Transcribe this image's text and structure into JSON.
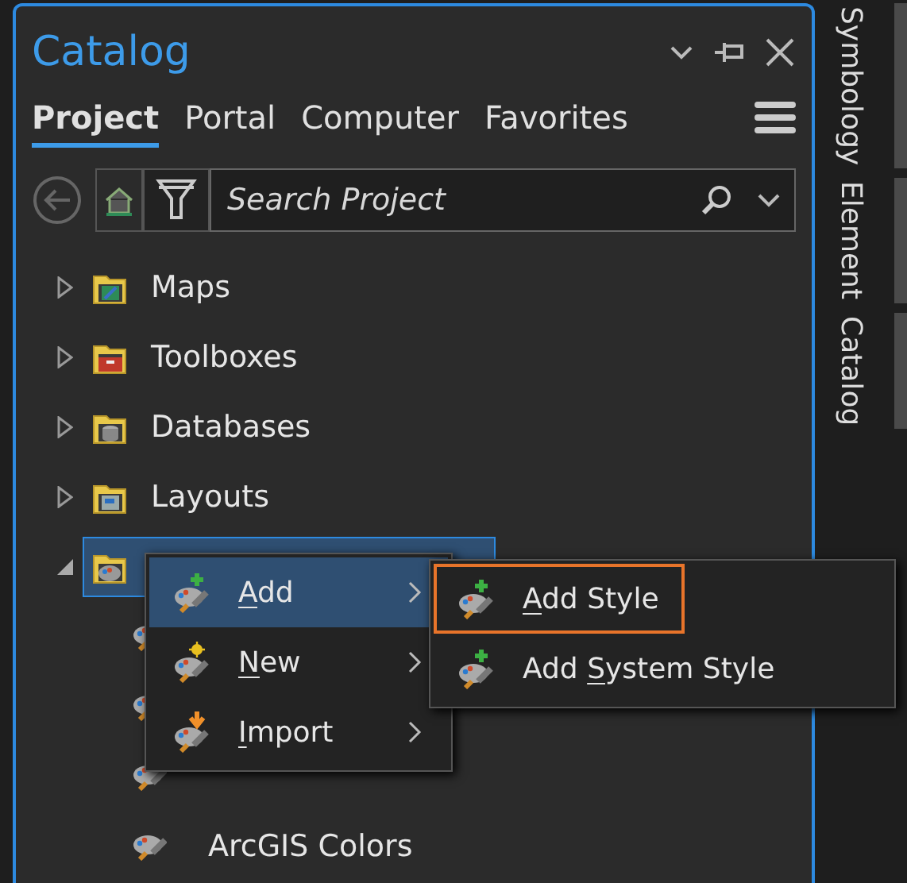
{
  "pane": {
    "title": "Catalog"
  },
  "tabs": [
    {
      "label": "Project",
      "selected": true
    },
    {
      "label": "Portal",
      "selected": false
    },
    {
      "label": "Computer",
      "selected": false
    },
    {
      "label": "Favorites",
      "selected": false
    }
  ],
  "search": {
    "placeholder": "Search Project"
  },
  "tree": [
    {
      "label": "Maps",
      "kind": "maps",
      "expanded": false,
      "selected": false
    },
    {
      "label": "Toolboxes",
      "kind": "toolbox",
      "expanded": false,
      "selected": false
    },
    {
      "label": "Databases",
      "kind": "database",
      "expanded": false,
      "selected": false
    },
    {
      "label": "Layouts",
      "kind": "layout",
      "expanded": false,
      "selected": false
    },
    {
      "kind": "styles",
      "expanded": true,
      "selected": true,
      "children": [
        {
          "kind": "style"
        },
        {
          "kind": "style"
        },
        {
          "kind": "style"
        },
        {
          "kind": "style",
          "label": "ArcGIS Colors"
        }
      ]
    }
  ],
  "context_menu": [
    {
      "access_key": "A",
      "label_rest": "dd",
      "kind": "add",
      "selected": true
    },
    {
      "access_key": "N",
      "label_rest": "ew",
      "kind": "new",
      "selected": false
    },
    {
      "access_key": "I",
      "label_rest": "mport",
      "kind": "import",
      "selected": false
    }
  ],
  "submenu": [
    {
      "access_key": "A",
      "label_rest": "dd Style",
      "kind": "add",
      "selected": true
    },
    {
      "label_start": "Add ",
      "access_key": "S",
      "label_rest": "ystem Style",
      "kind": "add",
      "selected": false
    }
  ],
  "side_tabs": [
    "Symbology",
    "Element",
    "Catalog"
  ]
}
